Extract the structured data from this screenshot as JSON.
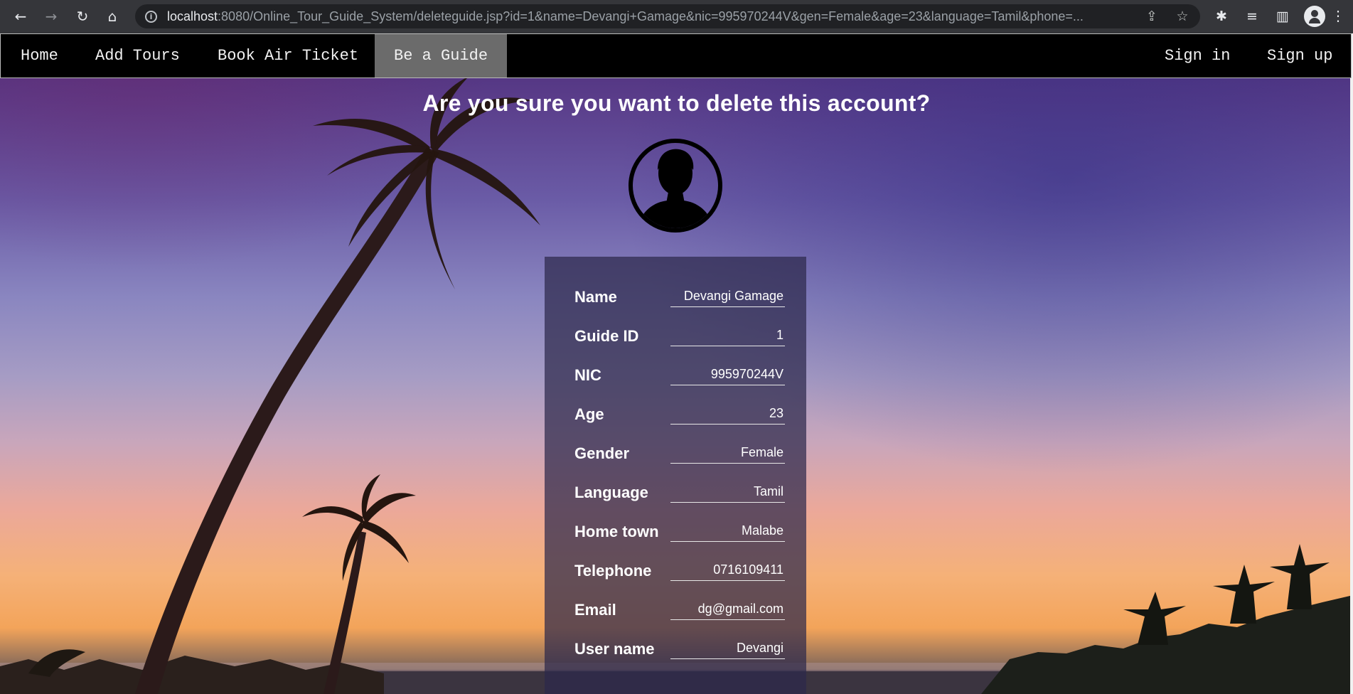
{
  "browser": {
    "url_host": "localhost",
    "url_rest": ":8080/Online_Tour_Guide_System/deleteguide.jsp?id=1&name=Devangi+Gamage&nic=995970244V&gen=Female&age=23&language=Tamil&phone=..."
  },
  "nav": {
    "left": [
      "Home",
      "Add Tours",
      "Book Air Ticket",
      "Be a Guide"
    ],
    "right": [
      "Sign in",
      "Sign up"
    ],
    "active": "Be a Guide",
    "active_color": "#6b6b6b"
  },
  "page": {
    "title": "Are you sure you want to delete this account?"
  },
  "fields": [
    {
      "label": "Name",
      "value": "Devangi Gamage"
    },
    {
      "label": "Guide ID",
      "value": "1"
    },
    {
      "label": "NIC",
      "value": "995970244V"
    },
    {
      "label": "Age",
      "value": "23"
    },
    {
      "label": "Gender",
      "value": "Female"
    },
    {
      "label": "Language",
      "value": "Tamil"
    },
    {
      "label": "Home town",
      "value": "Malabe"
    },
    {
      "label": "Telephone",
      "value": "0716109411"
    },
    {
      "label": "Email",
      "value": "dg@gmail.com"
    },
    {
      "label": "User name",
      "value": "Devangi"
    }
  ]
}
